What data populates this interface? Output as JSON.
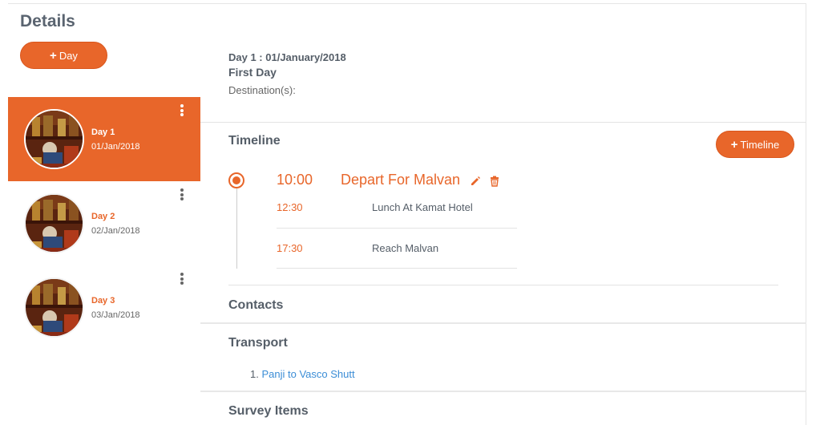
{
  "sidebar": {
    "title": "Details",
    "add_day_label": "Day",
    "days": [
      {
        "name": "Day 1",
        "date": "01/Jan/2018"
      },
      {
        "name": "Day 2",
        "date": "02/Jan/2018"
      },
      {
        "name": "Day 3",
        "date": "03/Jan/2018"
      }
    ]
  },
  "main": {
    "day_heading": "Day 1 : 01/January/2018",
    "day_subtitle": "First Day",
    "destination_label": "Destination(s):",
    "timeline": {
      "title": "Timeline",
      "add_label": "Timeline",
      "main_event": {
        "time": "10:00",
        "title": "Depart For Malvan"
      },
      "events": [
        {
          "time": "12:30",
          "title": "Lunch At Kamat Hotel"
        },
        {
          "time": "17:30",
          "title": "Reach Malvan"
        }
      ]
    },
    "contacts": {
      "title": "Contacts"
    },
    "transport": {
      "title": "Transport",
      "items": [
        {
          "number": "1.",
          "label": "Panji to Vasco Shutt"
        }
      ]
    },
    "survey": {
      "title": "Survey Items"
    }
  },
  "colors": {
    "accent": "#e8662a",
    "link": "#3b8dd6",
    "text": "#555e68"
  }
}
